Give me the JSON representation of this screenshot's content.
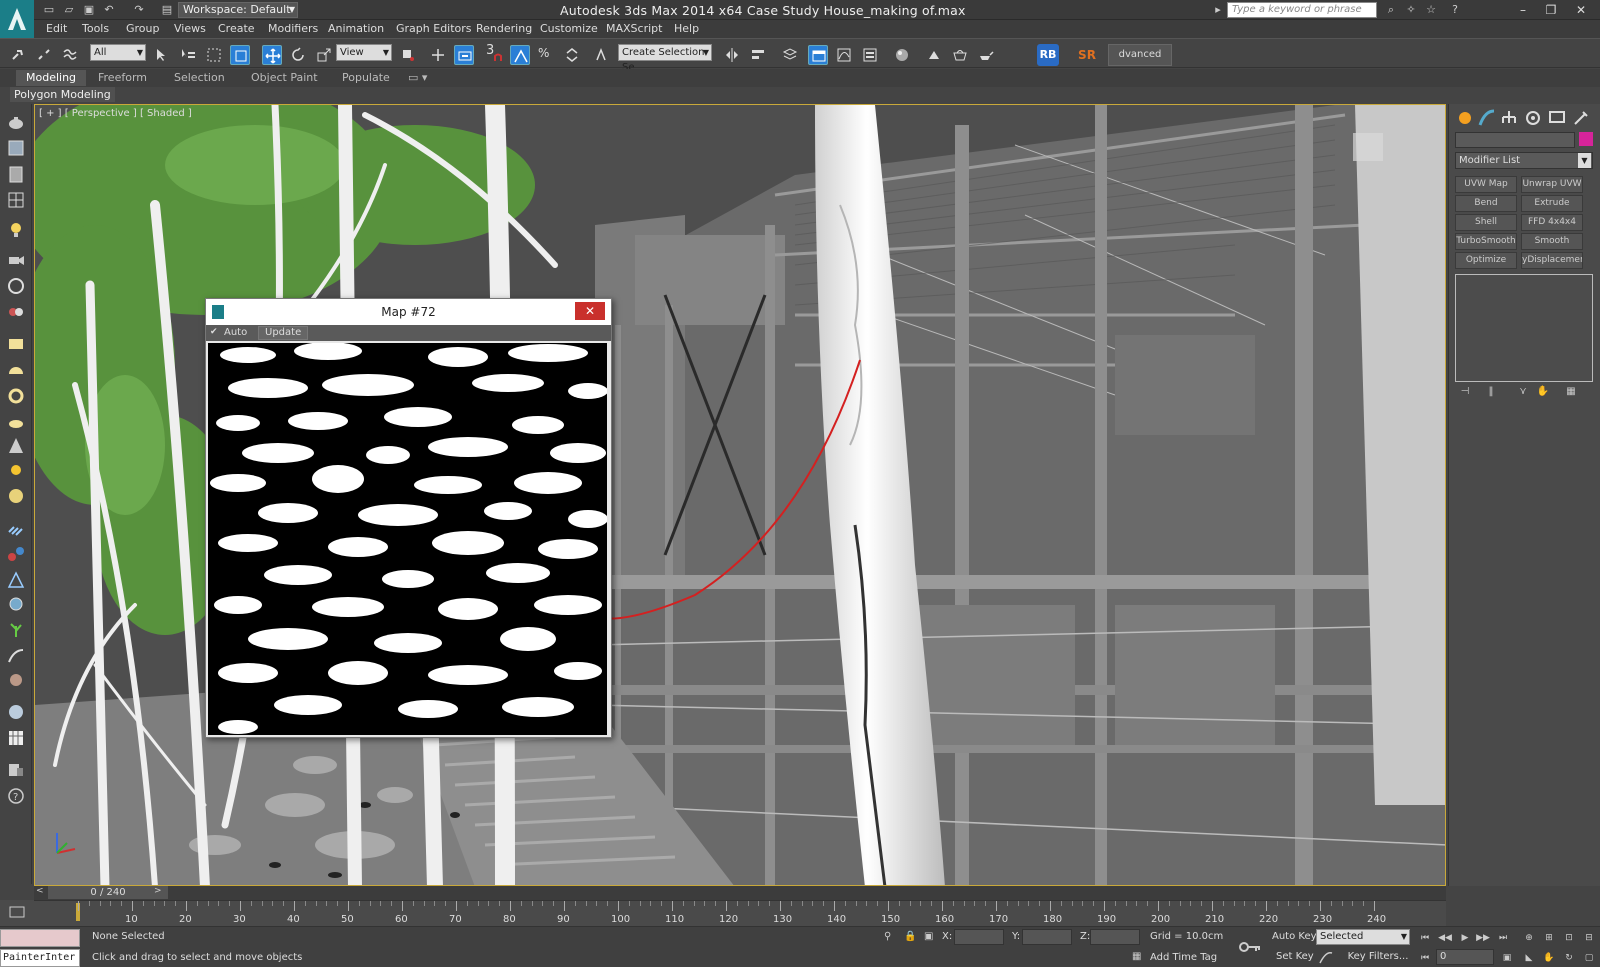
{
  "title": {
    "app_title": "Autodesk 3ds Max  2014 x64     Case Study House_making of.max",
    "workspace": "Workspace: Default",
    "search_placeholder": "Type a keyword or phrase"
  },
  "menu": [
    "Edit",
    "Tools",
    "Group",
    "Views",
    "Create",
    "Modifiers",
    "Animation",
    "Graph Editors",
    "Rendering",
    "Customize",
    "MAXScript",
    "Help"
  ],
  "toolbar": {
    "selection_filter": "All",
    "reference_coord": "View",
    "named_selection": "Create Selection Se",
    "snap_number": "3",
    "rb_label": "RB",
    "sr_label": "SR",
    "advanced_paint": "dvanced Paint"
  },
  "ribbon": {
    "tabs": [
      "Modeling",
      "Freeform",
      "Selection",
      "Object Paint",
      "Populate"
    ],
    "active_tab": "Modeling",
    "sub_panel": "Polygon Modeling"
  },
  "viewport": {
    "label": "[ + ] [ Perspective ] [ Shaded ]"
  },
  "map_window": {
    "title": "Map #72",
    "auto_label": "Auto",
    "update_label": "Update",
    "close_label": "✕"
  },
  "command_panel": {
    "modifier_list": "Modifier List",
    "color_swatch": "#d6249a",
    "modifiers": [
      "UVW Map",
      "Unwrap UVW",
      "Bend",
      "Extrude",
      "Shell",
      "FFD 4x4x4",
      "TurboSmooth",
      "Smooth",
      "Optimize",
      "yDisplacement"
    ]
  },
  "timeline": {
    "frame_readout": "0 / 240",
    "ticks": [
      10,
      20,
      30,
      40,
      50,
      60,
      70,
      80,
      90,
      100,
      110,
      120,
      130,
      140,
      150,
      160,
      170,
      180,
      190,
      200,
      210,
      220,
      230,
      240
    ]
  },
  "status": {
    "maxscript_line": "PainterInter",
    "selection": "None Selected",
    "prompt": "Click and drag to select and move objects",
    "x_label": "X:",
    "y_label": "Y:",
    "z_label": "Z:",
    "grid": "Grid = 10.0cm",
    "add_time_tag": "Add Time Tag",
    "auto_key": "Auto Key",
    "set_key": "Set Key",
    "selected_combo": "Selected",
    "key_filters": "Key Filters...",
    "current_frame": "0"
  }
}
